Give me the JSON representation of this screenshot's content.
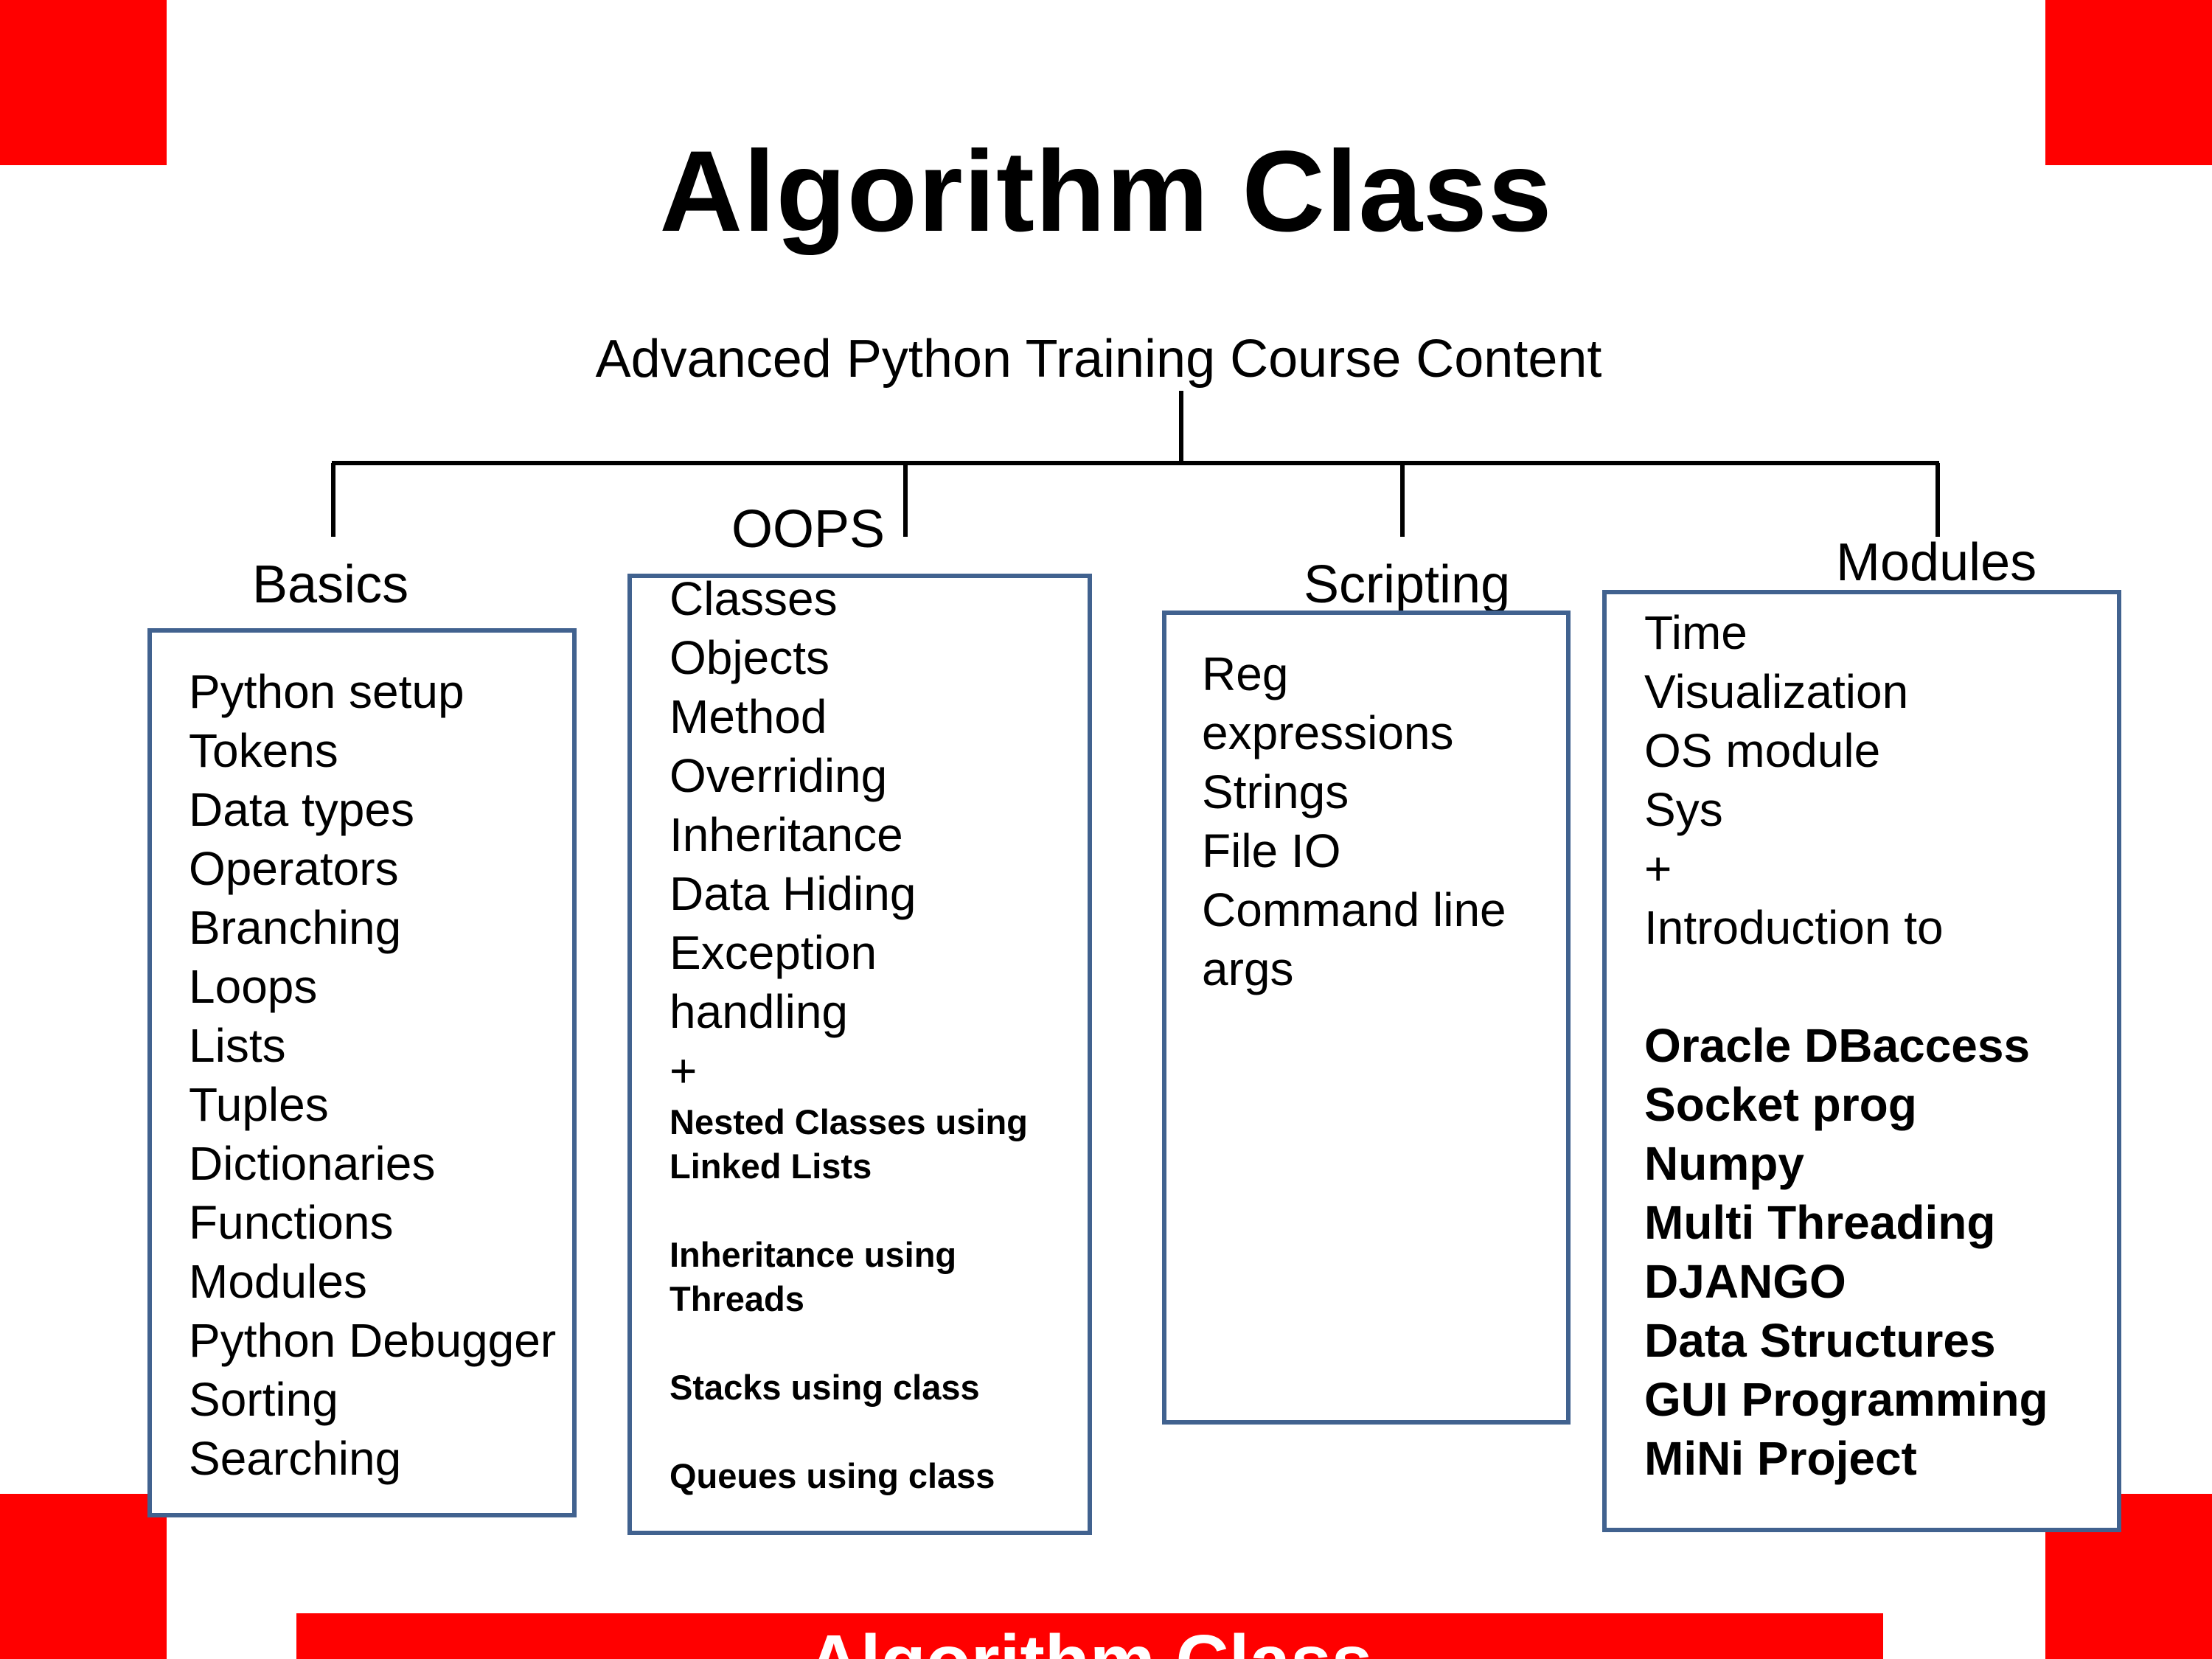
{
  "title": "Algorithm Class",
  "root": "Advanced Python Training Course Content",
  "footer": "Algorithm Class",
  "colors": {
    "accent": "#ff0000",
    "box_border": "#41628f"
  },
  "categories": {
    "basics": {
      "label": "Basics",
      "items": [
        "Python setup",
        "Tokens",
        "Data types",
        "Operators",
        "Branching",
        "Loops",
        "Lists",
        "Tuples",
        "Dictionaries",
        "Functions",
        "Modules",
        "Python Debugger",
        "Sorting",
        "Searching"
      ]
    },
    "oops": {
      "label": "OOPS",
      "items": [
        "Classes",
        "Objects",
        "Method",
        "Overriding",
        "Inheritance",
        "Data Hiding",
        "Exception",
        "handling",
        "+"
      ],
      "extras": [
        "Nested Classes using",
        "Linked Lists",
        "Inheritance using",
        "Threads",
        "Stacks using class",
        "Queues using class"
      ]
    },
    "scripting": {
      "label": "Scripting",
      "items": [
        "Reg",
        "expressions",
        "Strings",
        "File IO",
        "Command line",
        "args"
      ]
    },
    "modules": {
      "label": "Modules",
      "items": [
        "Time",
        "Visualization",
        "OS module",
        "Sys",
        "+",
        "Introduction to"
      ],
      "advanced": [
        "Oracle DBaccess",
        "Socket prog",
        "Numpy",
        "Multi Threading",
        "DJANGO",
        "Data Structures",
        "GUI Programming",
        "MiNi Project"
      ]
    }
  }
}
